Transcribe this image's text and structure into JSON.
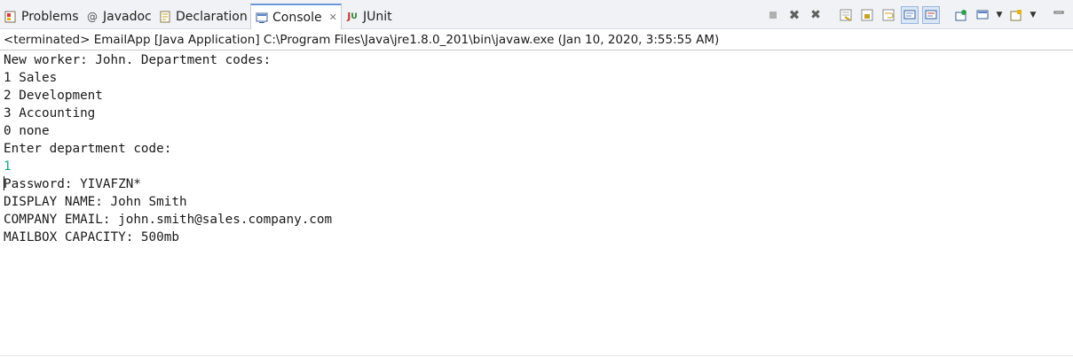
{
  "tabs": [
    {
      "label": "Problems",
      "icon": "problems-icon",
      "active": false
    },
    {
      "label": "Javadoc",
      "icon": "javadoc-icon",
      "active": false
    },
    {
      "label": "Declaration",
      "icon": "declaration-icon",
      "active": false
    },
    {
      "label": "Console",
      "icon": "console-icon",
      "active": true,
      "close_glyph": "✕"
    },
    {
      "label": "JUnit",
      "icon": "junit-icon",
      "active": false
    }
  ],
  "toolbar": {
    "icons": [
      "terminate-icon",
      "remove-launch-icon",
      "remove-all-terminated-icon",
      "clear-console-icon",
      "scroll-lock-icon",
      "word-wrap-icon",
      "show-on-stdout-icon",
      "show-on-stderr-icon",
      "pin-console-icon",
      "display-console-icon",
      "display-console-dropdown-icon",
      "open-console-icon",
      "open-console-dropdown-icon",
      "minimize-icon"
    ]
  },
  "status_text": "<terminated> EmailApp [Java Application] C:\\Program Files\\Java\\jre1.8.0_201\\bin\\javaw.exe (Jan 10, 2020, 3:55:55 AM)",
  "console": {
    "lines": [
      "New worker: John. Department codes:",
      "1 Sales",
      "2 Development",
      "3 Accounting",
      "0 none",
      "Enter department code:",
      "1",
      "Password: YIVAFZN*",
      "DISPLAY NAME: John Smith",
      "COMPANY EMAIL: john.smith@sales.company.com",
      "MAILBOX CAPACITY: 500mb"
    ],
    "input_color": "#1fa383"
  },
  "colors": {
    "tabbar_bg": "#f0f2f5",
    "active_tab_accent": "#6d96d6"
  }
}
